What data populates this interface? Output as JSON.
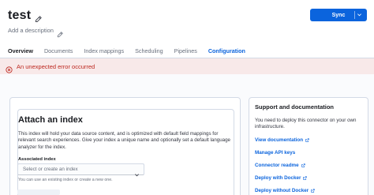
{
  "header": {
    "title": "test",
    "add_description": "Add a description",
    "sync_label": "Sync"
  },
  "tabs": [
    {
      "label": "Overview",
      "state": "bold"
    },
    {
      "label": "Documents",
      "state": "normal"
    },
    {
      "label": "Index mappings",
      "state": "normal"
    },
    {
      "label": "Scheduling",
      "state": "normal"
    },
    {
      "label": "Pipelines",
      "state": "normal"
    },
    {
      "label": "Configuration",
      "state": "active"
    }
  ],
  "error": {
    "message": "An unexpected error occurred"
  },
  "attach": {
    "title": "Attach an index",
    "description": "This index will hold your data source content, and is optimized with default field mappings for relevant search experiences. Give your index a unique name and optionally set a default language analyzer for the index.",
    "field_label": "Associated index",
    "select_placeholder": "Select or create an index",
    "help_text": "You can use an existing index or create a new one."
  },
  "support": {
    "title": "Support and documentation",
    "description": "You need to deploy this connector on your own infrastructure.",
    "links": [
      {
        "label": "View documentation",
        "external": true
      },
      {
        "label": "Manage API keys",
        "external": false
      },
      {
        "label": "Connector readme",
        "external": true
      },
      {
        "label": "Deploy with Docker",
        "external": true
      },
      {
        "label": "Deploy without Docker",
        "external": true
      }
    ]
  },
  "colors": {
    "accent": "#0b64dd",
    "danger": "#bd271e",
    "danger_bg": "#f8e9e9"
  },
  "icons": {
    "title_edit": "pencil-icon",
    "description_edit": "pencil-icon",
    "sync_menu": "chevron-down-icon",
    "error": "error-icon",
    "select": "chevron-down-icon",
    "external_link": "external-link-icon"
  }
}
